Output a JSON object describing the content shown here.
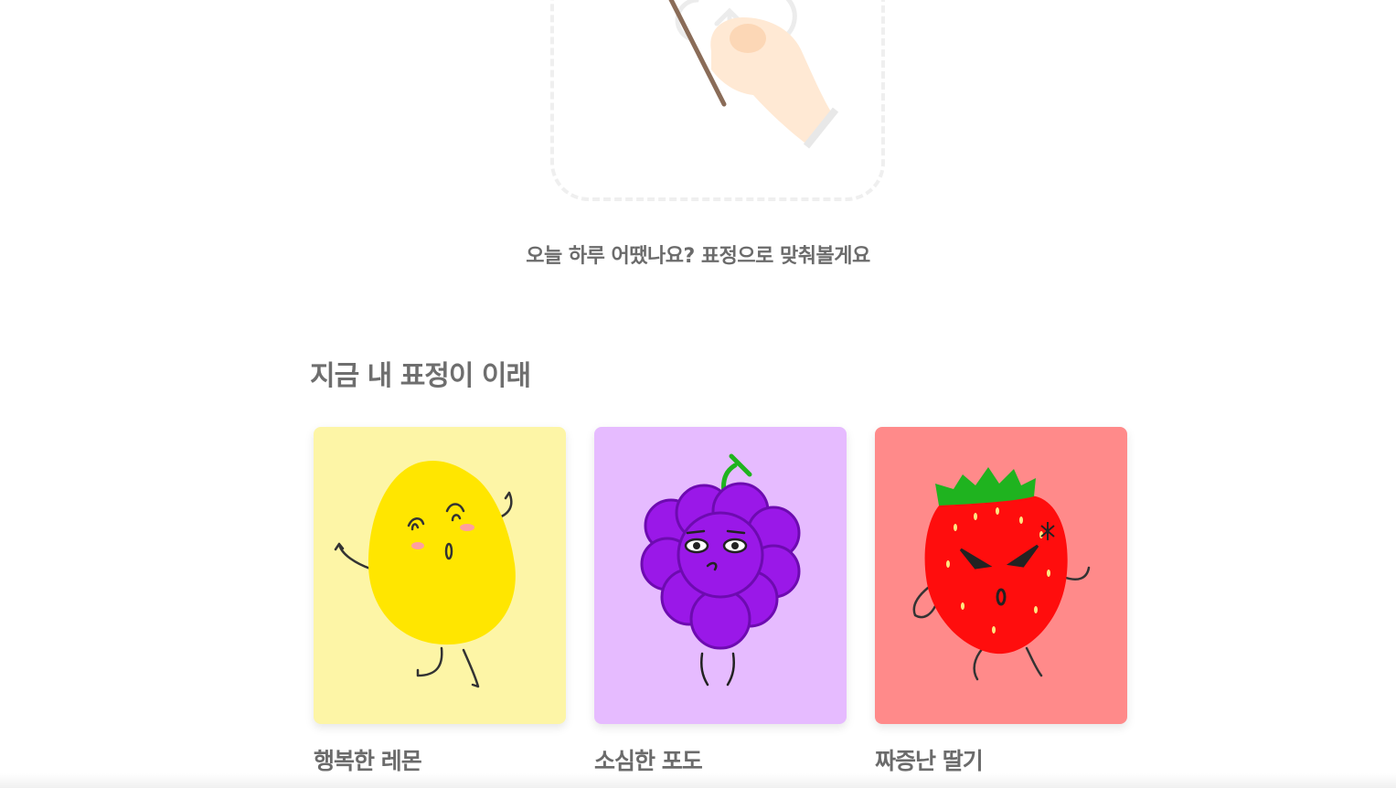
{
  "upload": {
    "icon": "upload-cloud-icon",
    "illustration": "hand-pointer-illustration"
  },
  "prompt_text": "오늘 하루 어땠나요? 표정으로 맞춰볼게요",
  "section_title": "지금 내 표정이 이래",
  "cards": [
    {
      "label": "행복한 레몬",
      "character": "lemon",
      "bg": "#fdf5a6",
      "fruit": "#ffe600"
    },
    {
      "label": "소심한 포도",
      "character": "grape",
      "bg": "#e6bbff",
      "fruit": "#9a18e8"
    },
    {
      "label": "짜증난 딸기",
      "character": "strawberry",
      "bg": "#ff8a8a",
      "fruit": "#ff0d0d"
    }
  ]
}
